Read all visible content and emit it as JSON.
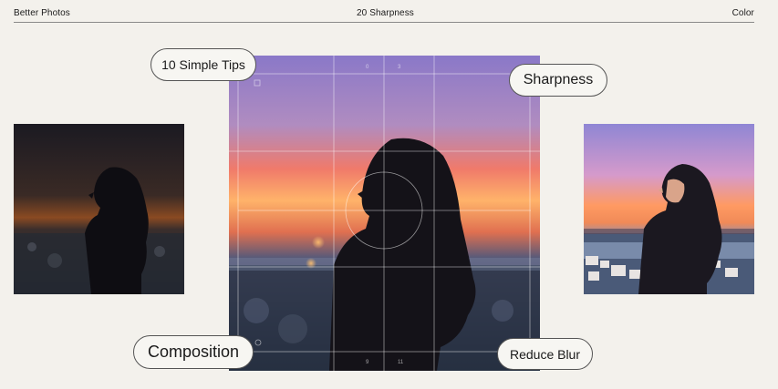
{
  "nav": {
    "left": "Better Photos",
    "center": "20 Sharpness",
    "right": "Color"
  },
  "labels": {
    "tips": "10 Simple Tips",
    "sharpness": "Sharpness",
    "composition": "Composition",
    "blur": "Reduce Blur"
  },
  "overlay": {
    "top_left_num": "0",
    "top_right_num": "3",
    "bottom_left_num": "9",
    "bottom_right_num": "11"
  },
  "colors": {
    "background": "#f3f1ec",
    "sky_top": "#8a78c8",
    "sky_mid": "#f08a5a",
    "sky_glow": "#ffb36a",
    "silhouette": "#141218"
  }
}
